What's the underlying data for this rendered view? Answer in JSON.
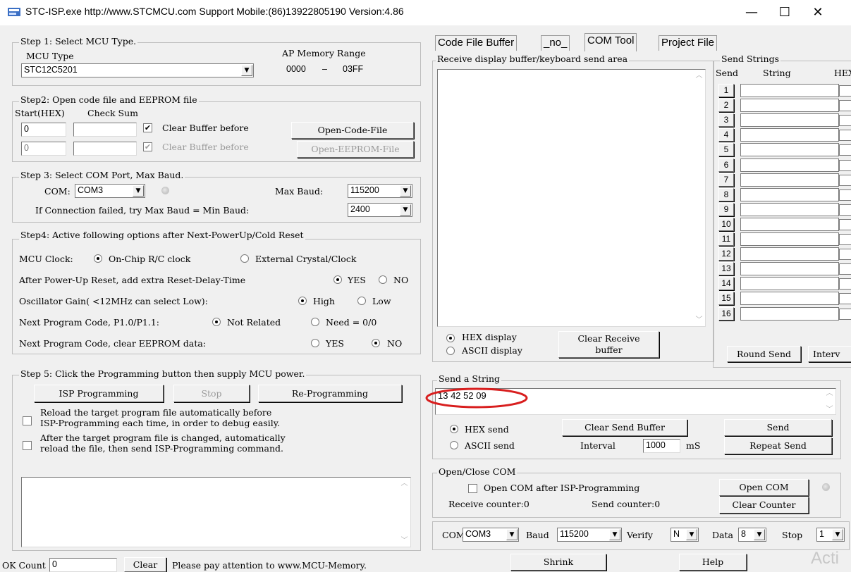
{
  "window": {
    "title": "STC-ISP.exe http://www.STCMCU.com Support Mobile:(86)13922805190 Version:4.86",
    "minimize": "—",
    "maximize": "☐",
    "close": "✕"
  },
  "step1": {
    "label": "Step 1: Select MCU Type.",
    "mcu_type_label": "MCU Type",
    "mcu_type_value": "STC12C5201",
    "ap_memory_label": "AP Memory Range",
    "ap_start": "0000",
    "ap_dash": "–",
    "ap_end": "03FF"
  },
  "step2": {
    "label": "Step2: Open code file and EEPROM file",
    "start_hex_label": "Start(HEX)",
    "check_sum_label": "Check Sum",
    "code_start": "0",
    "code_checksum": "",
    "eeprom_start": "0",
    "eeprom_checksum": "",
    "clear_buffer_label": "Clear Buffer before",
    "clear_buffer_label2": "Clear Buffer before",
    "open_code_file": "Open-Code-File",
    "open_eeprom_file": "Open-EEPROM-File"
  },
  "step3": {
    "label": "Step 3: Select COM Port, Max Baud.",
    "com_label": "COM:",
    "com_value": "COM3",
    "max_baud_label": "Max Baud:",
    "max_baud_value": "115200",
    "min_baud_label": "If Connection failed, try Max Baud = Min Baud:",
    "min_baud_value": "2400"
  },
  "step4": {
    "label": "Step4: Active following options after Next-PowerUp/Cold Reset",
    "mcu_clock_label": "MCU Clock:",
    "mcu_clock_opt1": "On-Chip R/C clock",
    "mcu_clock_opt2": "External Crystal/Clock",
    "reset_delay_label": "After Power-Up Reset, add extra Reset-Delay-Time",
    "reset_yes": "YES",
    "reset_no": "NO",
    "osc_gain_label": "Oscillator Gain( <12MHz can select Low):",
    "osc_high": "High",
    "osc_low": "Low",
    "next_code_label": "Next Program Code, P1.0/P1.1:",
    "not_related": "Not Related",
    "need_00": "Need = 0/0",
    "clear_eeprom_label": "Next Program Code, clear EEPROM data:",
    "clear_yes": "YES",
    "clear_no": "NO"
  },
  "step5": {
    "label": "Step 5: Click the Programming button then supply MCU power.",
    "isp_programming": "ISP Programming",
    "stop": "Stop",
    "re_programming": "Re-Programming",
    "reload_line1": "Reload the target program file automatically before",
    "reload_line2": "ISP-Programming each time, in order to debug easily.",
    "after_line1": "After the target program file is changed, automatically",
    "after_line2": "reload the file, then send ISP-Programming command."
  },
  "statusbar": {
    "ok_count_label": "OK Count",
    "ok_count_value": "0",
    "clear": "Clear",
    "message": "Please pay attention to www.MCU-Memory."
  },
  "tabs": [
    {
      "label": "Code File Buffer"
    },
    {
      "label": "_no_"
    },
    {
      "label": "COM Tool"
    },
    {
      "label": "Project File"
    }
  ],
  "receive": {
    "label": "Receive display buffer/keyboard send area",
    "hex_display": "HEX display",
    "ascii_display": "ASCII display",
    "clear_receive_line1": "Clear Receive",
    "clear_receive_line2": "buffer"
  },
  "send_strings": {
    "label": "Send Strings",
    "col_send": "Send",
    "col_string": "String",
    "col_hex": "HEX",
    "rows": [
      "1",
      "2",
      "3",
      "4",
      "5",
      "6",
      "7",
      "8",
      "9",
      "10",
      "11",
      "12",
      "13",
      "14",
      "15",
      "16"
    ],
    "round_send": "Round Send",
    "interval": "Interv"
  },
  "send_a_string": {
    "label": "Send a String",
    "value": "13 42 52 09",
    "hex_send": "HEX send",
    "ascii_send": "ASCII send",
    "clear_send_buffer": "Clear Send Buffer",
    "interval_label": "Interval",
    "interval_value": "1000",
    "interval_unit": "mS",
    "send": "Send",
    "repeat_send": "Repeat Send",
    "highlight_color": "#d81e1e"
  },
  "open_close_com": {
    "label": "Open/Close COM",
    "open_after_isp": "Open COM after ISP-Programming",
    "receive_counter": "Receive counter:0",
    "send_counter": "Send counter:0",
    "open_com": "Open COM",
    "clear_counter": "Clear Counter"
  },
  "com_settings": {
    "com_label": "COM",
    "com_value": "COM3",
    "baud_label": "Baud",
    "baud_value": "115200",
    "verify_label": "Verify",
    "verify_value": "N",
    "data_label": "Data",
    "data_value": "8",
    "stop_label": "Stop",
    "stop_value": "1"
  },
  "bottom_buttons": {
    "shrink": "Shrink",
    "help": "Help"
  },
  "watermark": "Acti"
}
